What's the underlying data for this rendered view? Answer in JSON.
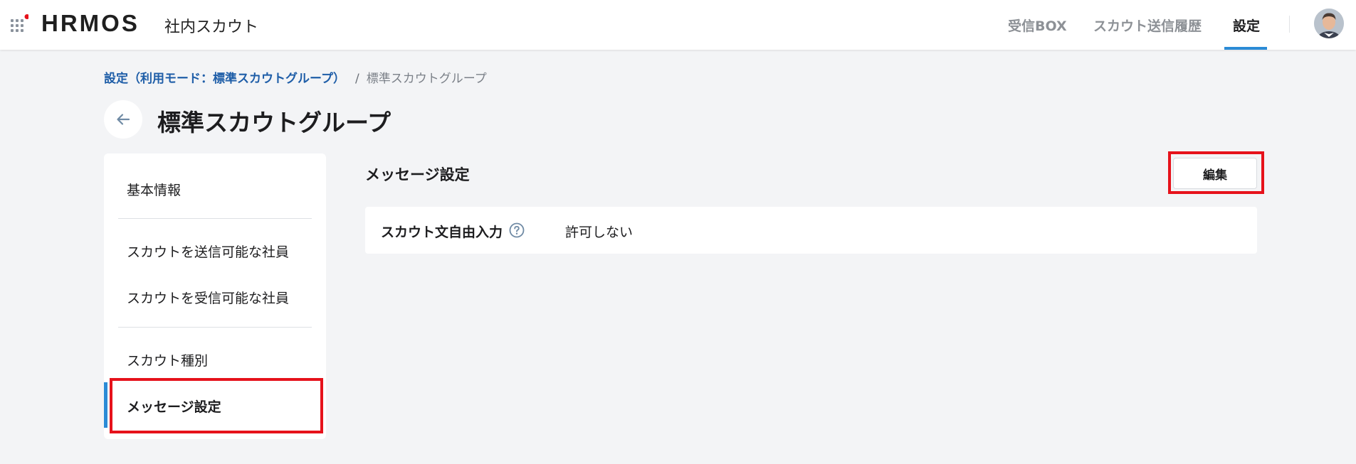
{
  "header": {
    "logo_text": "HRMOS",
    "product_name": "社内スカウト",
    "nav": [
      {
        "label": "受信BOX",
        "active": false
      },
      {
        "label": "スカウト送信履歴",
        "active": false
      },
      {
        "label": "設定",
        "active": true
      }
    ],
    "accent_color": "#2b8bd6",
    "logo_dot_color": "#e6121b"
  },
  "breadcrumb": {
    "parent": "設定（利用モード：標準スカウトグループ）",
    "separator": "/",
    "current": "標準スカウトグループ"
  },
  "page": {
    "title": "標準スカウトグループ"
  },
  "sidebar": {
    "items": [
      {
        "label": "基本情報",
        "active": false
      },
      {
        "label": "スカウトを送信可能な社員",
        "active": false
      },
      {
        "label": "スカウトを受信可能な社員",
        "active": false
      },
      {
        "label": "スカウト種別",
        "active": false
      },
      {
        "label": "メッセージ設定",
        "active": true
      }
    ]
  },
  "main": {
    "section_title": "メッセージ設定",
    "edit_label": "編集",
    "settings": [
      {
        "label": "スカウト文自由入力",
        "value": "許可しない",
        "help_icon": "question-circle-icon"
      }
    ]
  },
  "annotations": {
    "highlight_color": "#e6121b"
  }
}
